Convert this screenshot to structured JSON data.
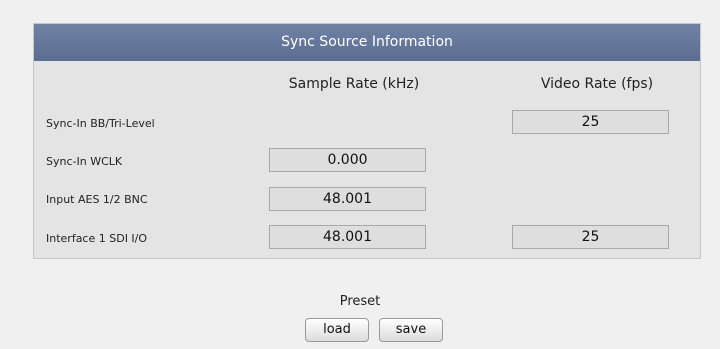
{
  "panel": {
    "title": "Sync Source Information",
    "columns": {
      "sample_rate": "Sample Rate (kHz)",
      "video_rate": "Video Rate (fps)"
    },
    "rows": [
      {
        "label": "Sync-In BB/Tri-Level",
        "sample_rate": "",
        "video_rate": "25"
      },
      {
        "label": "Sync-In WCLK",
        "sample_rate": "0.000",
        "video_rate": ""
      },
      {
        "label": "Input AES 1/2 BNC",
        "sample_rate": "48.001",
        "video_rate": ""
      },
      {
        "label": "Interface 1 SDI I/O",
        "sample_rate": "48.001",
        "video_rate": "25"
      }
    ]
  },
  "preset": {
    "label": "Preset",
    "load_label": "load",
    "save_label": "save"
  },
  "colors": {
    "header_bg": "#6f82a4",
    "panel_bg": "#e4e4e4",
    "field_bg": "#dedede"
  }
}
